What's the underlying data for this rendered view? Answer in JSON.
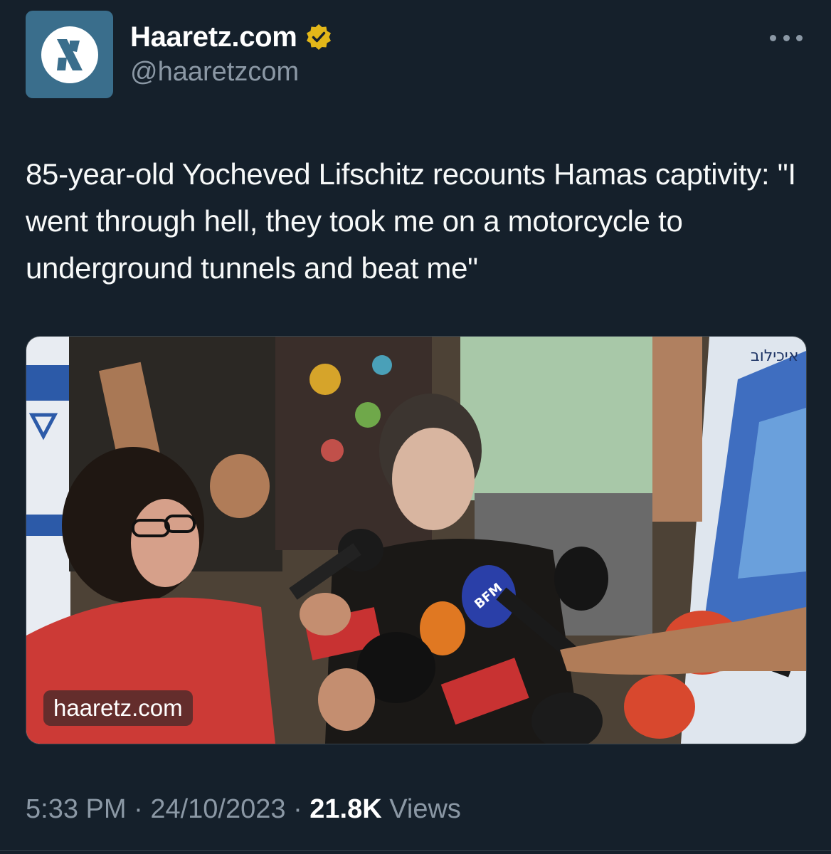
{
  "author": {
    "display_name": "Haaretz.com",
    "handle": "@haaretzcom",
    "verified": true,
    "verified_badge_color": "#e2b719",
    "avatar_bg": "#3a6e8c"
  },
  "tweet": {
    "text": "85-year-old Yocheved Lifschitz recounts Hamas captivity: \"I went through hell, they took me on a motorcycle to underground tunnels and beat me\"",
    "media": {
      "watermark": "haaretz.com",
      "sign_text": "איכילוב"
    },
    "time": "5:33 PM",
    "separator": "·",
    "date": "24/10/2023",
    "views_count": "21.8K",
    "views_label": "Views"
  },
  "icons": {
    "avatar": "haaretz-logo-icon",
    "verified": "verified-badge-icon",
    "more": "more-options-icon"
  }
}
